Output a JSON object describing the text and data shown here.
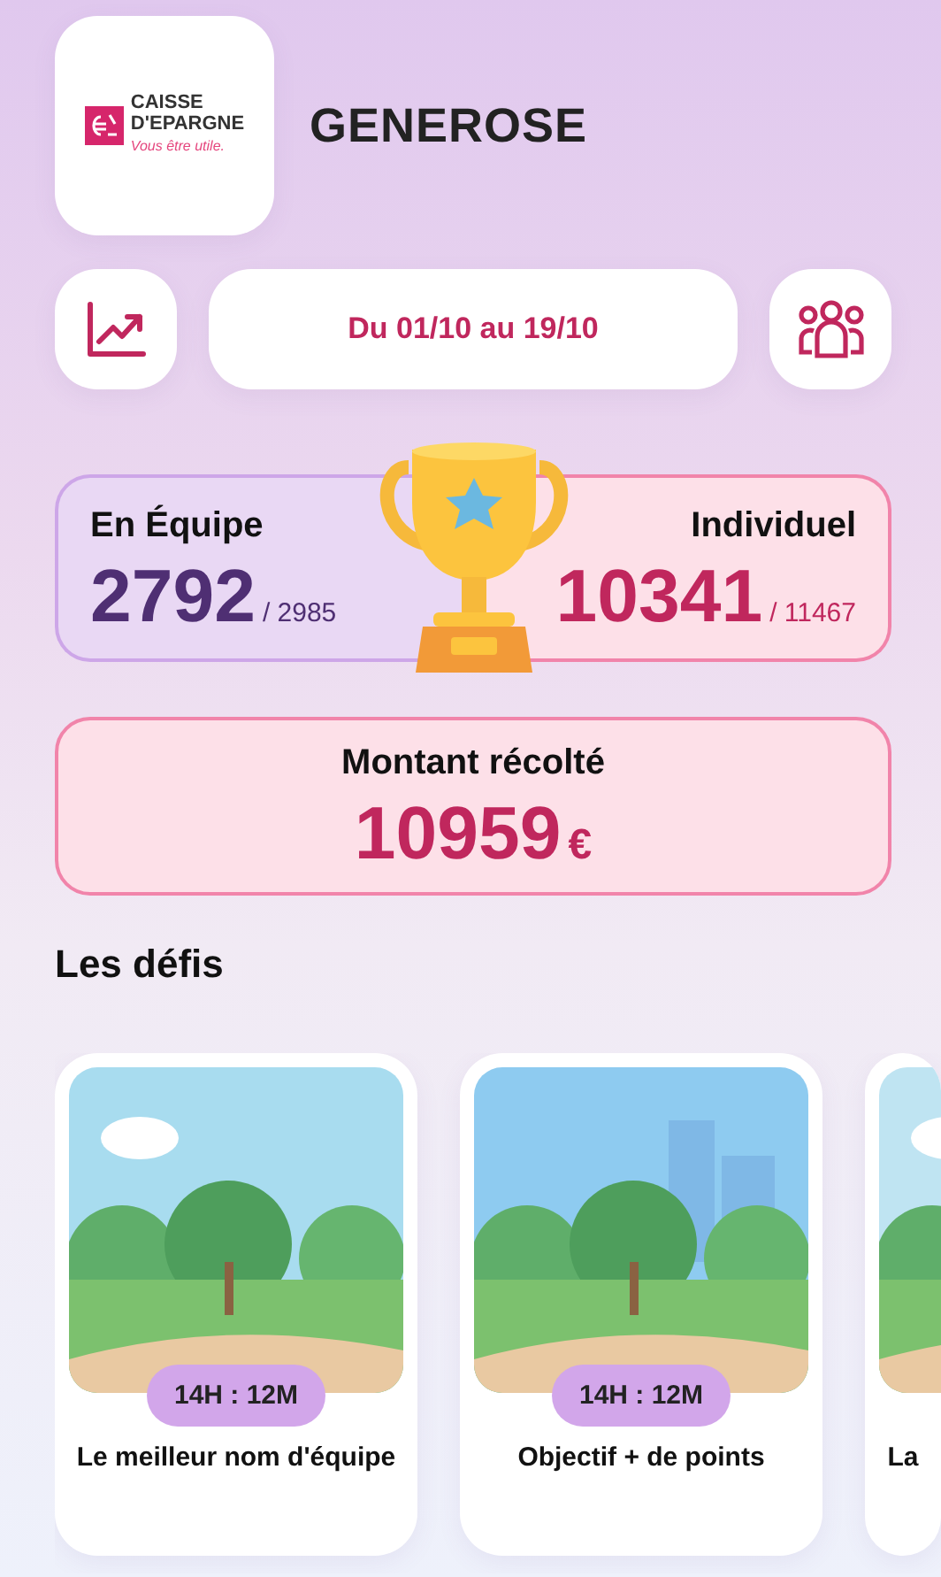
{
  "brand": {
    "name_lines": [
      "CAISSE",
      "D'EPARGNE"
    ],
    "tagline": "Vous être utile."
  },
  "title": "GENEROSE",
  "period": "Du 01/10 au 19/10",
  "scores": [
    {
      "kind": "team",
      "label": "En Équipe",
      "value": "2792",
      "total": "/ 2985"
    },
    {
      "kind": "individual",
      "label": "Individuel",
      "value": "10341",
      "total": "/ 11467"
    }
  ],
  "amount": {
    "label": "Montant récolté",
    "value": "10959",
    "currency": "€"
  },
  "section_title": "Les défis",
  "challenges": [
    {
      "timer": "14H : 12M",
      "title": "Le meilleur nom d'équipe"
    },
    {
      "timer": "14H : 12M",
      "title": "Objectif + de points"
    },
    {
      "title": "La"
    }
  ]
}
